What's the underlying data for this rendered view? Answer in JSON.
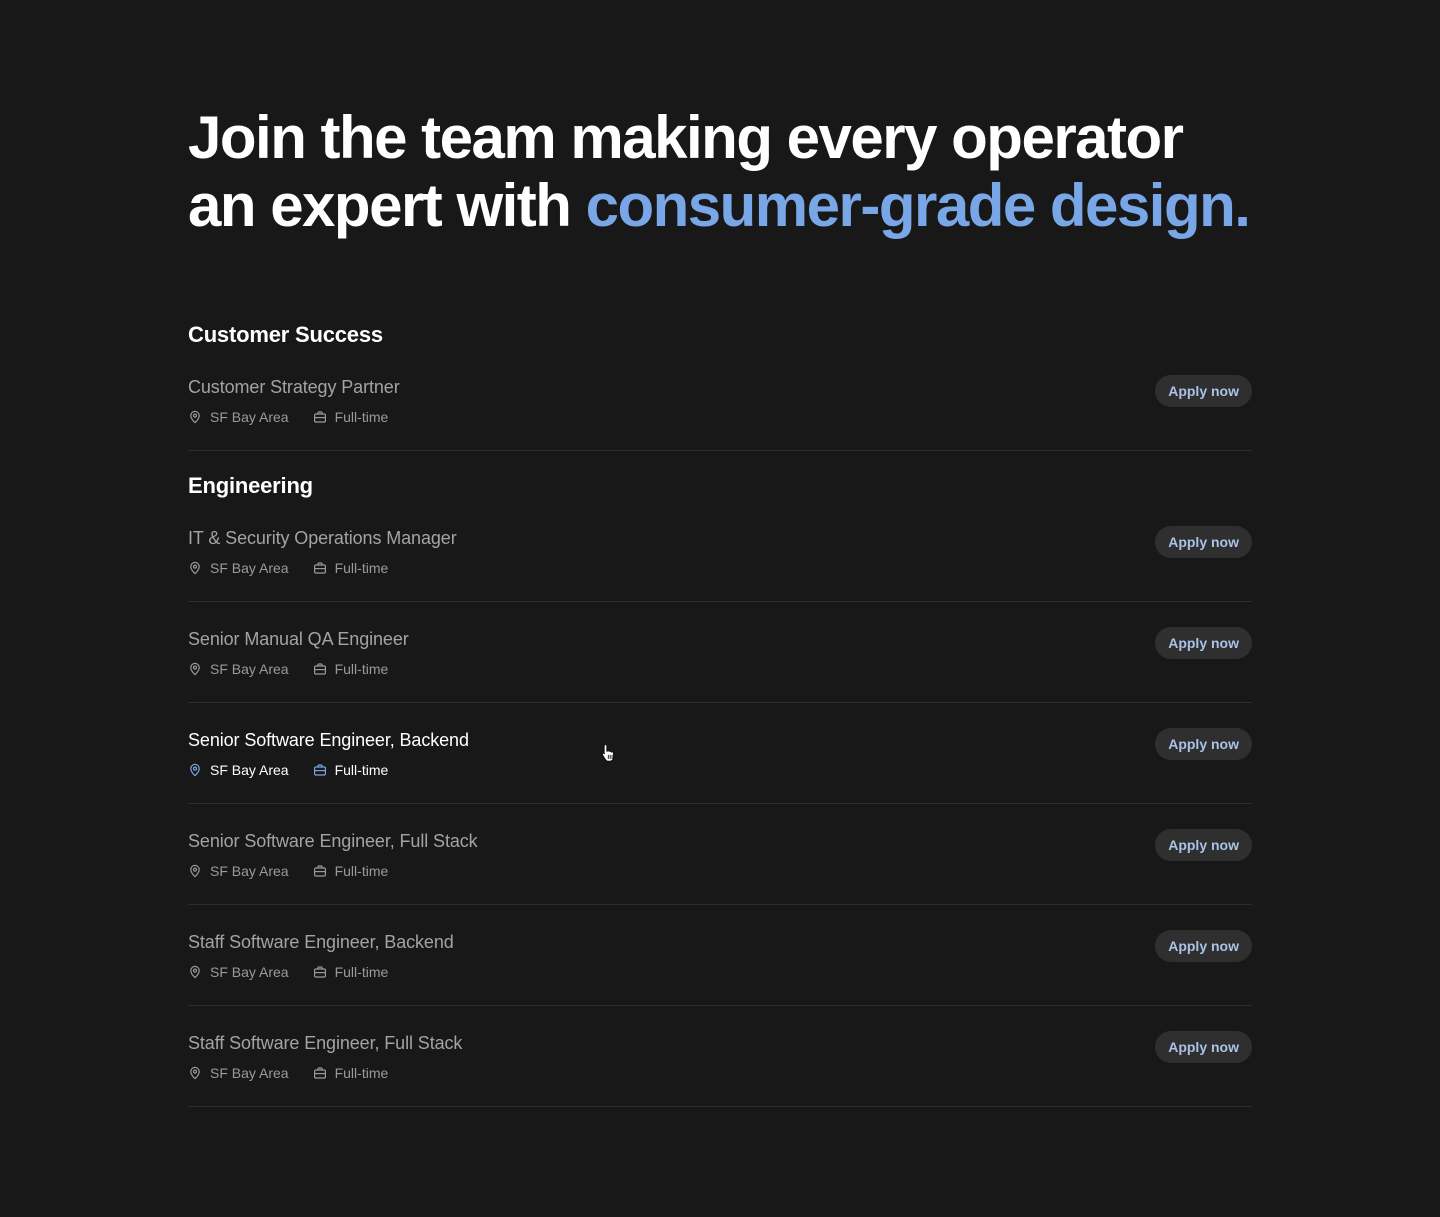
{
  "theme": {
    "background": "#181818",
    "accent": "#78a6e6",
    "button_bg": "#2f2f2f",
    "button_text": "#a9c2e6",
    "muted_text": "#a3a3a3"
  },
  "hero": {
    "line1": "Join the team making every operator",
    "line2_plain": "an expert with ",
    "line2_accent": "consumer-grade design."
  },
  "departments": [
    {
      "name": "Customer Success",
      "jobs": [
        {
          "title": "Customer Strategy Partner",
          "location": "SF Bay Area",
          "type": "Full-time",
          "apply_label": "Apply now"
        }
      ]
    },
    {
      "name": "Engineering",
      "jobs": [
        {
          "title": "IT & Security Operations Manager",
          "location": "SF Bay Area",
          "type": "Full-time",
          "apply_label": "Apply now"
        },
        {
          "title": "Senior Manual QA Engineer",
          "location": "SF Bay Area",
          "type": "Full-time",
          "apply_label": "Apply now"
        },
        {
          "title": "Senior Software Engineer, Backend",
          "location": "SF Bay Area",
          "type": "Full-time",
          "apply_label": "Apply now",
          "hovered": true
        },
        {
          "title": "Senior Software Engineer, Full Stack",
          "location": "SF Bay Area",
          "type": "Full-time",
          "apply_label": "Apply now"
        },
        {
          "title": "Staff Software Engineer, Backend",
          "location": "SF Bay Area",
          "type": "Full-time",
          "apply_label": "Apply now"
        },
        {
          "title": "Staff Software Engineer, Full Stack",
          "location": "SF Bay Area",
          "type": "Full-time",
          "apply_label": "Apply now"
        }
      ]
    }
  ],
  "icons": {
    "location": "map-pin-icon",
    "type": "briefcase-icon",
    "cursor": "pointer-hand-icon"
  }
}
